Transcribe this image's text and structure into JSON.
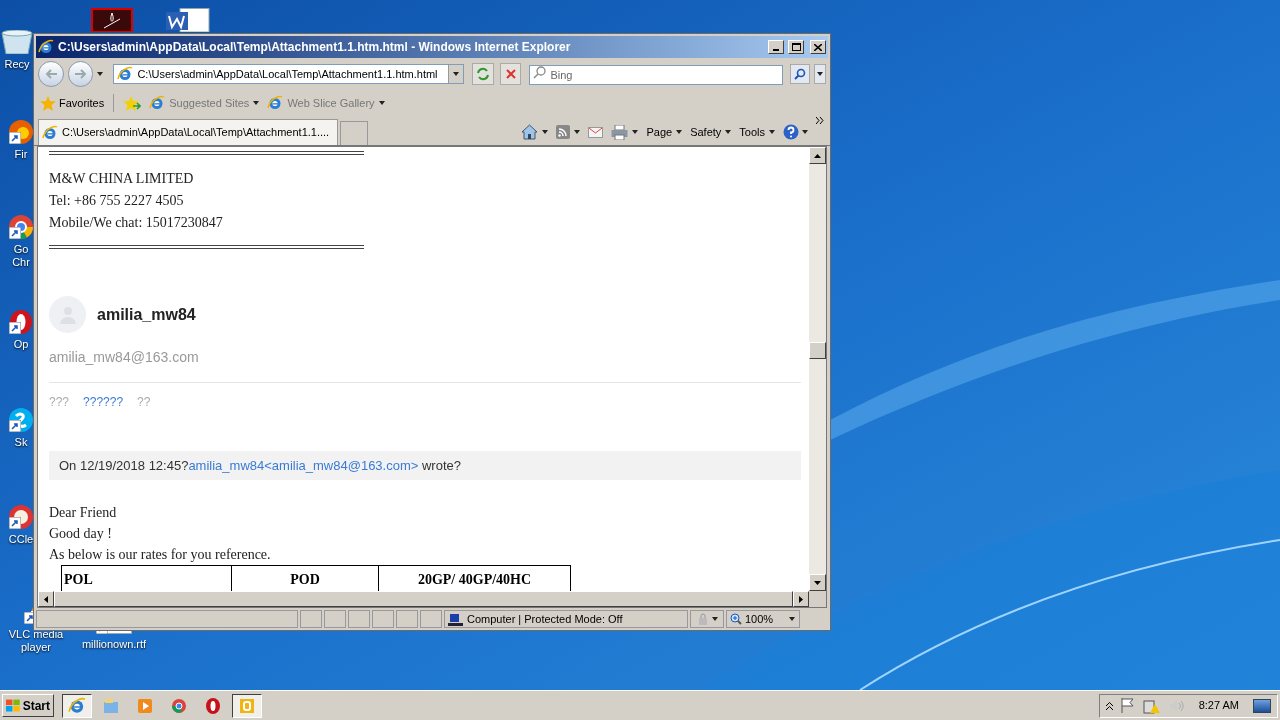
{
  "desktop": {
    "icons": [
      {
        "kind": "recycle",
        "label": "Recy"
      },
      {
        "kind": "pdf"
      },
      {
        "kind": "word"
      },
      {
        "kind": "firefox",
        "label": "Fir"
      },
      {
        "kind": "chrome",
        "label": "Go\nChr"
      },
      {
        "kind": "opera",
        "label": "Op"
      },
      {
        "kind": "skype",
        "label": "Sk"
      },
      {
        "kind": "ccleaner",
        "label": "CCle"
      },
      {
        "kind": "vlc",
        "label": "VLC media\nplayer"
      },
      {
        "kind": "document",
        "label": "millionown.rtf"
      }
    ]
  },
  "window": {
    "title": "C:\\Users\\admin\\AppData\\Local\\Temp\\Attachment1.1.htm.html - Windows Internet Explorer",
    "address": "C:\\Users\\admin\\AppData\\Local\\Temp\\Attachment1.1.htm.html",
    "search": {
      "placeholder": "Bing"
    },
    "favorites_bar": {
      "label": "Favorites",
      "links": [
        "Suggested Sites",
        "Web Slice Gallery"
      ]
    },
    "tabs": [
      {
        "label": "C:\\Users\\admin\\AppData\\Local\\Temp\\Attachment1.1....",
        "selected": true
      }
    ],
    "command_bar": [
      "Page",
      "Safety",
      "Tools"
    ],
    "status_bar": {
      "zone": "Computer | Protected Mode: Off",
      "zoom": "100%"
    }
  },
  "page": {
    "signature": [
      "M&W CHINA LIMITED",
      "Tel: +86 755 2227 4505",
      "Mobile/We chat: 15017230847"
    ],
    "sender": {
      "name": "amilia_mw84",
      "email": "amilia_mw84@163.com"
    },
    "actions": [
      {
        "label": "???",
        "kind": "plain"
      },
      {
        "label": "??????",
        "kind": "link"
      },
      {
        "label": "??",
        "kind": "plain"
      }
    ],
    "quote": {
      "prefix": "On 12/19/2018 12:45?",
      "link": "amilia_mw84<amilia_mw84@163.com>",
      "suffix": " wrote?"
    },
    "body": [
      "Dear Friend",
      "Good day !",
      "As below is our rates for you reference."
    ],
    "table": {
      "columns": [
        "POL",
        "POD",
        "20GP/ 40GP/40HC"
      ]
    }
  },
  "taskbar": {
    "start": "Start",
    "apps": [
      {
        "kind": "ie",
        "selected": true
      },
      {
        "kind": "explorer",
        "selected": false
      },
      {
        "kind": "media",
        "selected": false
      },
      {
        "kind": "chrome",
        "selected": false
      },
      {
        "kind": "opera",
        "selected": false
      },
      {
        "kind": "folder",
        "selected": true
      }
    ],
    "clock": "8:27 AM"
  }
}
